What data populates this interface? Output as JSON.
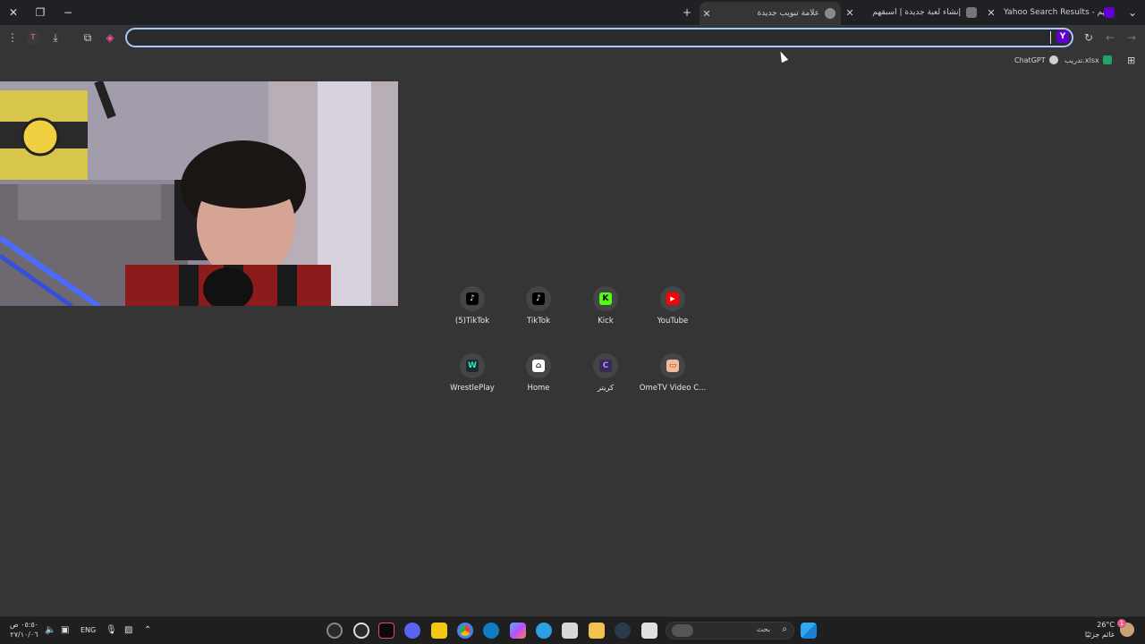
{
  "tabs": [
    {
      "title": "Yahoo Search Results - اسبقهم",
      "favicon_color": "#6001d2"
    },
    {
      "title": "إنشاء لعبة جديدة | اسبقهم",
      "favicon_color": "#c8c8c8"
    },
    {
      "title": "علامة تبويب جديدة",
      "favicon_color": "#c8c8c8",
      "active": true
    }
  ],
  "omnibox": {
    "value": "",
    "placeholder": ""
  },
  "bookmarks": [
    {
      "label": "تدريب.xlsx",
      "icon_color": "#21a366"
    },
    {
      "label": "ChatGPT",
      "icon_color": "#d0d0d0"
    }
  ],
  "shortcuts": [
    {
      "label": "(5)TikTok",
      "icon": "tiktok-icon",
      "icon_bg": "#000000",
      "icon_fg": "#ffffff",
      "glyph": "♪"
    },
    {
      "label": "TikTok",
      "icon": "tiktok-icon",
      "icon_bg": "#000000",
      "icon_fg": "#ffffff",
      "glyph": "♪"
    },
    {
      "label": "Kick",
      "icon": "kick-icon",
      "icon_bg": "#53fc18",
      "icon_fg": "#000000",
      "glyph": "K"
    },
    {
      "label": "YouTube",
      "icon": "youtube-icon",
      "icon_bg": "#ff0000",
      "icon_fg": "#ffffff",
      "glyph": "▶"
    },
    {
      "label": "WrestlePlay",
      "icon": "wrestleplay-icon",
      "icon_bg": "#1a2a2e",
      "icon_fg": "#37e6c8",
      "glyph": "W"
    },
    {
      "label": "Home",
      "icon": "home-icon",
      "icon_bg": "#ffffff",
      "icon_fg": "#333333",
      "glyph": "⌂"
    },
    {
      "label": "كريتر",
      "icon": "crater-icon",
      "icon_bg": "#3a2a5a",
      "icon_fg": "#b98cff",
      "glyph": "C"
    },
    {
      "label": "OmeTV Video C...",
      "icon": "ometv-icon",
      "icon_bg": "#f2b8a0",
      "icon_fg": "#c0392b",
      "glyph": "▭"
    }
  ],
  "taskbar": {
    "time": "٠٥:٥٠ ص",
    "date": "٢٧/١٠/٠٦",
    "language": "ENG",
    "search_placeholder": "بحث",
    "weather_temp": "26°C",
    "weather_desc": "غائم جزئيًا",
    "notification_count": "1"
  }
}
